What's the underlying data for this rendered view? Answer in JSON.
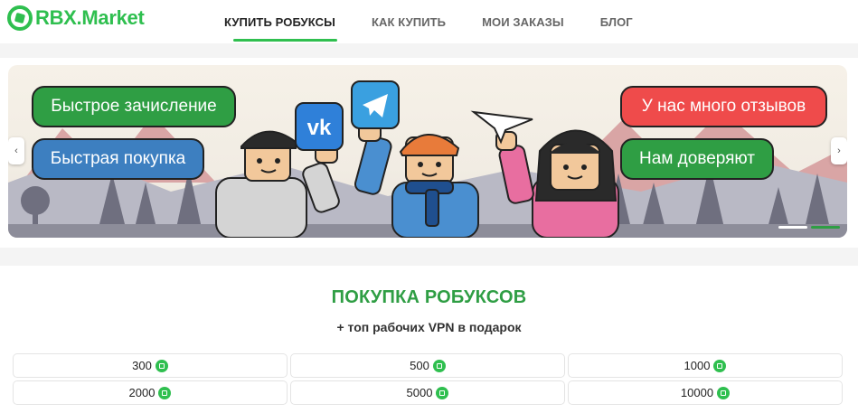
{
  "brand": {
    "name": "RBX.Market",
    "color": "#2fbf4f"
  },
  "nav": {
    "items": [
      {
        "label": "КУПИТЬ РОБУКСЫ",
        "active": true
      },
      {
        "label": "КАК КУПИТЬ",
        "active": false
      },
      {
        "label": "МОИ ЗАКАЗЫ",
        "active": false
      },
      {
        "label": "БЛОГ",
        "active": false
      }
    ]
  },
  "banner": {
    "left_pills": [
      "Быстрое зачисление",
      "Быстрая покупка"
    ],
    "right_pills": [
      "У нас много отзывов",
      "Нам доверяют"
    ],
    "prev_icon": "‹",
    "next_icon": "›",
    "slide_count": 2,
    "active_slide": 2
  },
  "purchase": {
    "title": "ПОКУПКА РОБУКСОВ",
    "subtitle": "+ топ рабочих VPN в подарок",
    "amounts": [
      "300",
      "500",
      "1000",
      "2000",
      "5000",
      "10000"
    ],
    "currency_icon": "robux-coin-icon"
  },
  "colors": {
    "accent_green": "#2f9e44",
    "pill_blue": "#3d7fc0",
    "pill_red": "#ef4b4b"
  }
}
